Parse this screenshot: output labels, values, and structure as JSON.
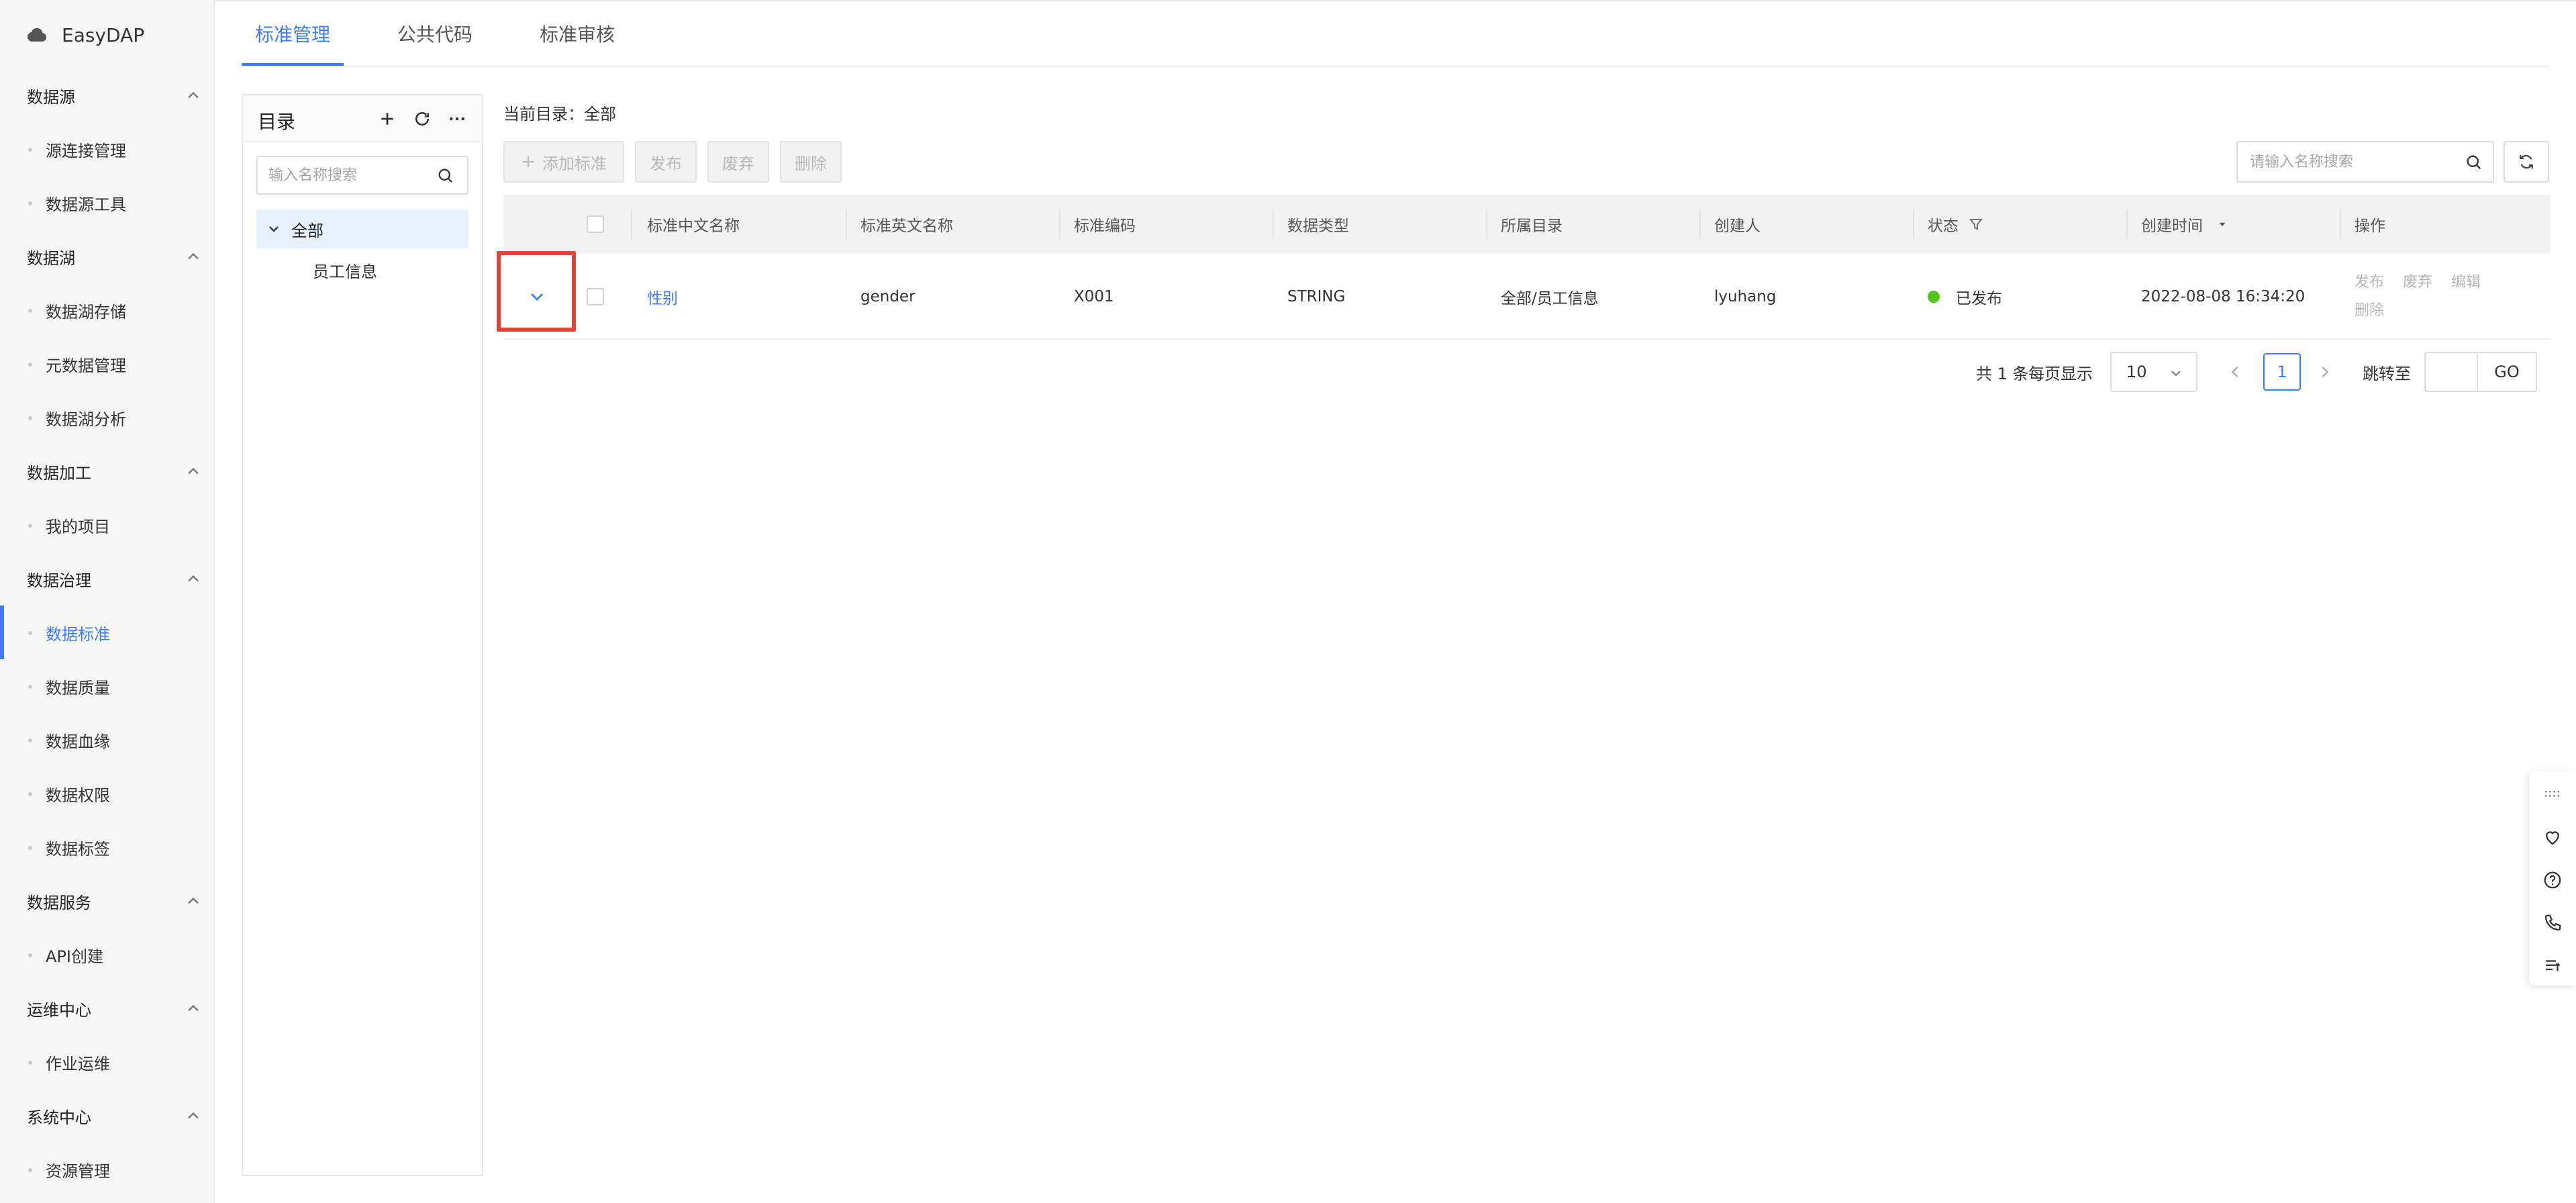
{
  "app": {
    "name": "EasyDAP"
  },
  "sidebar": {
    "groups": [
      {
        "label": "数据源",
        "items": [
          "源连接管理",
          "数据源工具"
        ]
      },
      {
        "label": "数据湖",
        "items": [
          "数据湖存储",
          "元数据管理",
          "数据湖分析"
        ]
      },
      {
        "label": "数据加工",
        "items": [
          "我的项目"
        ]
      },
      {
        "label": "数据治理",
        "items": [
          "数据标准",
          "数据质量",
          "数据血缘",
          "数据权限",
          "数据标签"
        ]
      },
      {
        "label": "数据服务",
        "items": [
          "API创建"
        ]
      },
      {
        "label": "运维中心",
        "items": [
          "作业运维"
        ]
      },
      {
        "label": "系统中心",
        "items": [
          "资源管理"
        ]
      }
    ],
    "active_item": "数据标准"
  },
  "tabs": [
    "标准管理",
    "公共代码",
    "标准审核"
  ],
  "directory": {
    "title": "目录",
    "search_placeholder": "输入名称搜索",
    "root": "全部",
    "children": [
      "员工信息"
    ]
  },
  "main": {
    "breadcrumb": "当前目录：全部",
    "buttons": {
      "add": "添加标准",
      "publish": "发布",
      "discard": "废弃",
      "delete": "删除"
    },
    "search_placeholder": "请输入名称搜索"
  },
  "table": {
    "columns": [
      "标准中文名称",
      "标准英文名称",
      "标准编码",
      "数据类型",
      "所属目录",
      "创建人",
      "状态",
      "创建时间",
      "操作"
    ],
    "rows": [
      {
        "cn_name": "性别",
        "en_name": "gender",
        "code": "X001",
        "type": "STRING",
        "dir": "全部/员工信息",
        "creator": "lyuhang",
        "status": "已发布",
        "created": "2022-08-08 16:34:20",
        "ops": [
          "发布",
          "废弃",
          "编辑",
          "删除"
        ]
      }
    ]
  },
  "pagination": {
    "total": "共 1 条",
    "page_size_label": "每页显示",
    "page_size": "10",
    "current_page": "1",
    "jump_label": "跳转至",
    "go": "GO"
  },
  "colors": {
    "accent": "#3e7cf7",
    "status_published": "#52c41a",
    "highlight": "#e04437"
  }
}
